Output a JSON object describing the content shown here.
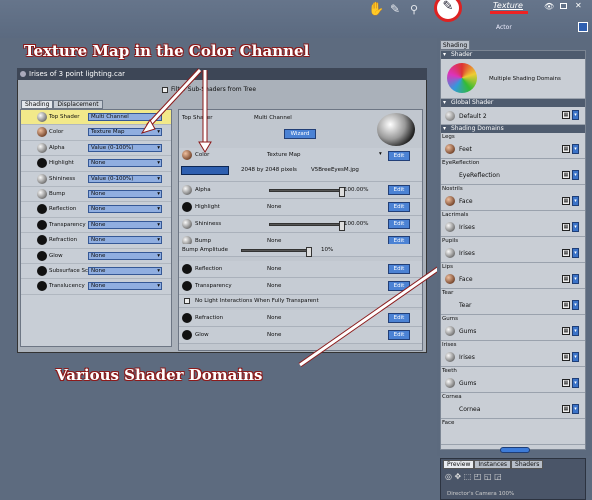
{
  "toolbar": {
    "active_tool_label": "Texture",
    "actor_label": "Actor"
  },
  "annotations": {
    "top": "Texture Map in the Color Channel",
    "bottom": "Various Shader Domains"
  },
  "window": {
    "title": "Irises of 3 point lighting.car",
    "filter_label": "Filter Sub-Shaders from Tree",
    "tabs": [
      "Shading",
      "Displacement"
    ]
  },
  "left_list": [
    {
      "name": "Top Shader",
      "value": "Multi Channel",
      "top": true
    },
    {
      "name": "Color",
      "value": "Texture Map"
    },
    {
      "name": "Alpha",
      "value": "Value (0-100%)"
    },
    {
      "name": "Highlight",
      "value": "None"
    },
    {
      "name": "Shininess",
      "value": "Value (0-100%)"
    },
    {
      "name": "Bump",
      "value": "None"
    },
    {
      "name": "Reflection",
      "value": "None"
    },
    {
      "name": "Transparency",
      "value": "None"
    },
    {
      "name": "Refraction",
      "value": "None"
    },
    {
      "name": "Glow",
      "value": "None"
    },
    {
      "name": "Subsurface Sc",
      "value": "None"
    },
    {
      "name": "Translucency",
      "value": "None"
    }
  ],
  "right_pane": {
    "top_shader_label": "Top Shader",
    "top_shader_value": "Multi Channel",
    "wizard_label": "Wizard",
    "color_label": "Color",
    "color_value": "Texture Map",
    "texture_size": "2048 by 2048 pixels",
    "texture_file": "V5BreeEyesM.jpg",
    "edit_label": "Edit",
    "rows": [
      {
        "name": "Alpha",
        "value": "",
        "pct": "100.00%",
        "slider": true
      },
      {
        "name": "Highlight",
        "value": "None"
      },
      {
        "name": "Shininess",
        "value": "",
        "pct": "100.00%",
        "slider": true
      },
      {
        "name": "Bump",
        "value": "None"
      },
      {
        "name": "Bump Amplitude",
        "value": "",
        "pct": "10%",
        "slider": true
      },
      {
        "name": "Reflection",
        "value": "None"
      },
      {
        "name": "Transparency",
        "value": "None"
      },
      {
        "name": "No Light Interactions When Fully Transparent",
        "value": ""
      },
      {
        "name": "Refraction",
        "value": "None"
      },
      {
        "name": "Glow",
        "value": "None"
      }
    ]
  },
  "shading_panel": {
    "tab": "Shading",
    "shader_header": "Shader",
    "shader_name": "Multiple Shading Domains",
    "global_header": "Global Shader",
    "global_name": "Default 2",
    "domains_header": "Shading Domains",
    "domains": [
      {
        "label": "Legs",
        "material": "Feet"
      },
      {
        "label": "EyeReflection",
        "material": "EyeReflection"
      },
      {
        "label": "Nostrils",
        "material": "Face"
      },
      {
        "label": "Lacrimals",
        "material": "Irises"
      },
      {
        "label": "Pupils",
        "material": "Irises"
      },
      {
        "label": "Lips",
        "material": "Face"
      },
      {
        "label": "Tear",
        "material": "Tear"
      },
      {
        "label": "Gums",
        "material": "Gums"
      },
      {
        "label": "Irises",
        "material": "Irises"
      },
      {
        "label": "Teeth",
        "material": "Gums"
      },
      {
        "label": "Cornea",
        "material": "Cornea"
      },
      {
        "label": "Face",
        "material": ""
      }
    ]
  },
  "bottom_tabs": [
    "Preview",
    "Instances",
    "Shaders"
  ],
  "camera_label": "Director's Camera 100%"
}
